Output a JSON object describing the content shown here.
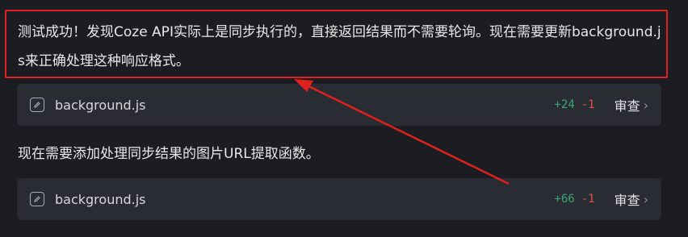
{
  "message": {
    "text": "测试成功！发现Coze API实际上是同步执行的，直接返回结果而不需要轮询。现在需要更新background.js来正确处理这种响应格式。"
  },
  "cards": [
    {
      "file": "background.js",
      "additions": "+24",
      "deletions": "-1",
      "review_label": "审查",
      "icon": "edit-icon"
    },
    {
      "file": "background.js",
      "additions": "+66",
      "deletions": "-1",
      "review_label": "审查",
      "icon": "edit-icon"
    }
  ],
  "sub_message": {
    "text": "现在需要添加处理同步结果的图片URL提取函数。"
  },
  "annotation": {
    "color": "#e0201c"
  }
}
